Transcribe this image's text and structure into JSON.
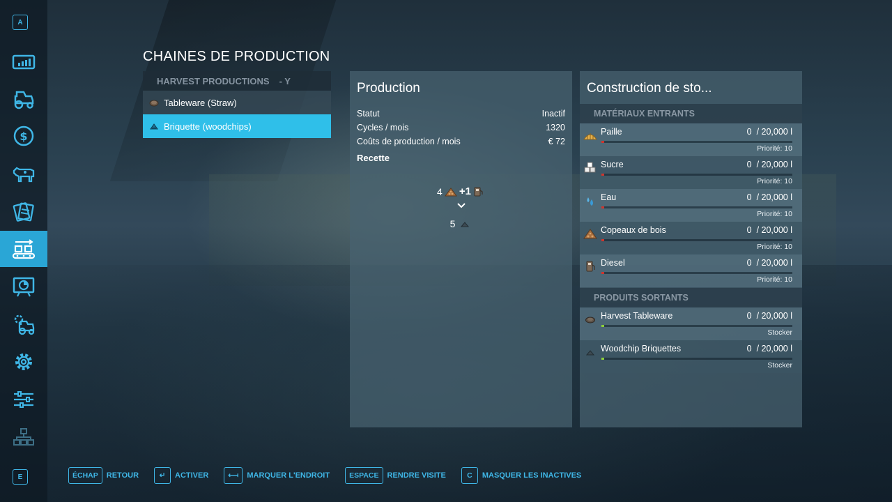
{
  "title": "CHAINES DE PRODUCTION",
  "sidebar": {
    "top_key": "A",
    "bottom_key": "E",
    "items": [
      {
        "name": "prices-icon"
      },
      {
        "name": "vehicles-icon"
      },
      {
        "name": "finances-icon"
      },
      {
        "name": "animals-icon"
      },
      {
        "name": "contracts-icon"
      },
      {
        "name": "production-chains-icon",
        "active": true
      },
      {
        "name": "help-icon"
      },
      {
        "name": "garage-icon"
      },
      {
        "name": "settings-icon"
      },
      {
        "name": "controls-icon"
      },
      {
        "name": "map-overview-icon"
      }
    ]
  },
  "production_list": {
    "header": "HARVEST PRODUCTIONS",
    "header_suffix": "- Y",
    "items": [
      {
        "label": "Tableware (Straw)",
        "selected": false
      },
      {
        "label": "Briquette (woodchips)",
        "selected": true
      }
    ]
  },
  "production_panel": {
    "title": "Production",
    "stats": [
      {
        "label": "Statut",
        "value": "Inactif"
      },
      {
        "label": "Cycles / mois",
        "value": "1320"
      },
      {
        "label": "Coûts de production / mois",
        "value": "€ 72"
      }
    ],
    "recipe_label": "Recette",
    "recipe": {
      "input_1_qty": "4",
      "input_2_qty": "+1",
      "output_qty": "5"
    }
  },
  "storage_panel": {
    "title": "Construction de sto...",
    "inputs_header": "MATÉRIAUX ENTRANTS",
    "inputs": [
      {
        "name": "Paille",
        "amount": "0",
        "capacity": "/ 20,000 l",
        "sub": "Priorité: 10",
        "icon": "straw-icon",
        "fill": 0.0
      },
      {
        "name": "Sucre",
        "amount": "0",
        "capacity": "/ 20,000 l",
        "sub": "Priorité: 10",
        "icon": "sugar-icon",
        "fill": 0.0
      },
      {
        "name": "Eau",
        "amount": "0",
        "capacity": "/ 20,000 l",
        "sub": "Priorité: 10",
        "icon": "water-icon",
        "fill": 0.0
      },
      {
        "name": "Copeaux de bois",
        "amount": "0",
        "capacity": "/ 20,000 l",
        "sub": "Priorité: 10",
        "icon": "woodchips-icon",
        "fill": 0.0
      },
      {
        "name": "Diesel",
        "amount": "0",
        "capacity": "/ 20,000 l",
        "sub": "Priorité: 10",
        "icon": "diesel-icon",
        "fill": 0.0
      }
    ],
    "outputs_header": "PRODUITS SORTANTS",
    "outputs": [
      {
        "name": "Harvest Tableware",
        "amount": "0",
        "capacity": "/ 20,000 l",
        "sub": "Stocker",
        "icon": "tableware-icon",
        "fill": 0.0
      },
      {
        "name": "Woodchip Briquettes",
        "amount": "0",
        "capacity": "/ 20,000 l",
        "sub": "Stocker",
        "icon": "briquette-icon",
        "fill": 0.0
      }
    ]
  },
  "bottom_bar": [
    {
      "key": "ÉCHAP",
      "label": "RETOUR"
    },
    {
      "key": "↵",
      "label": "ACTIVER"
    },
    {
      "key": "⟻",
      "label": "MARQUER L'ENDROIT"
    },
    {
      "key": "ESPACE",
      "label": "RENDRE VISITE"
    },
    {
      "key": "C",
      "label": "MASQUER LES INACTIVES"
    }
  ],
  "colors": {
    "accent": "#2fbfe9",
    "key_blue": "#3fb6e6",
    "input_bar_mark": "#d0342c",
    "output_bar_mark": "#8ccf3a"
  }
}
